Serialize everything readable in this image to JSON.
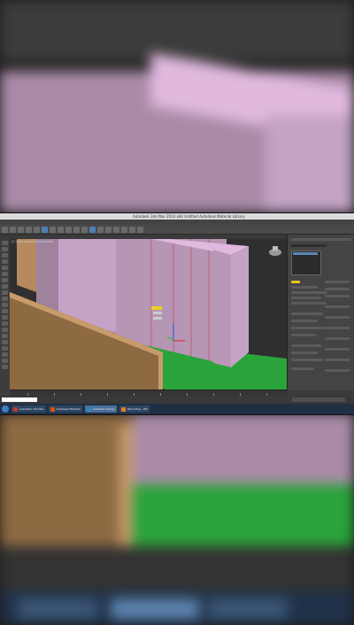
{
  "app": {
    "window_title": "Autodesk 3ds Max 2014 x64    Untitled   Autodesk Material Library",
    "menu_items": [
      "Edit",
      "Tools",
      "Group",
      "Views",
      "Create",
      "Modifiers",
      "Animation",
      "Graph Editors",
      "Rendering",
      "Customize",
      "MAXScript",
      "Help"
    ],
    "viewport_label": "[+] [Perspective] [Shaded]",
    "command_panel": {
      "object_name": "Box001",
      "modifier_selected": "Box"
    },
    "timeline": {
      "frame_display": "0 / 100"
    },
    "taskbar": {
      "items": [
        {
          "label": "Autodesk 3ds Max",
          "active": false,
          "icon_color": "#c0392b"
        },
        {
          "label": "Autodesk Material",
          "active": false,
          "icon_color": "#d35400"
        },
        {
          "label": "Autodesk Design",
          "active": true,
          "icon_color": "#2e86c1"
        },
        {
          "label": "Recording - RM",
          "active": false,
          "icon_color": "#e67e22"
        }
      ]
    }
  },
  "colors": {
    "wall_pink": "#c4a3c6",
    "wall_pink_dark": "#a98ba8",
    "wall_top": "#e1b9df",
    "ground_green": "#2aa43a",
    "wood_tan": "#b48a5e",
    "wood_dark": "#8e6a43"
  }
}
